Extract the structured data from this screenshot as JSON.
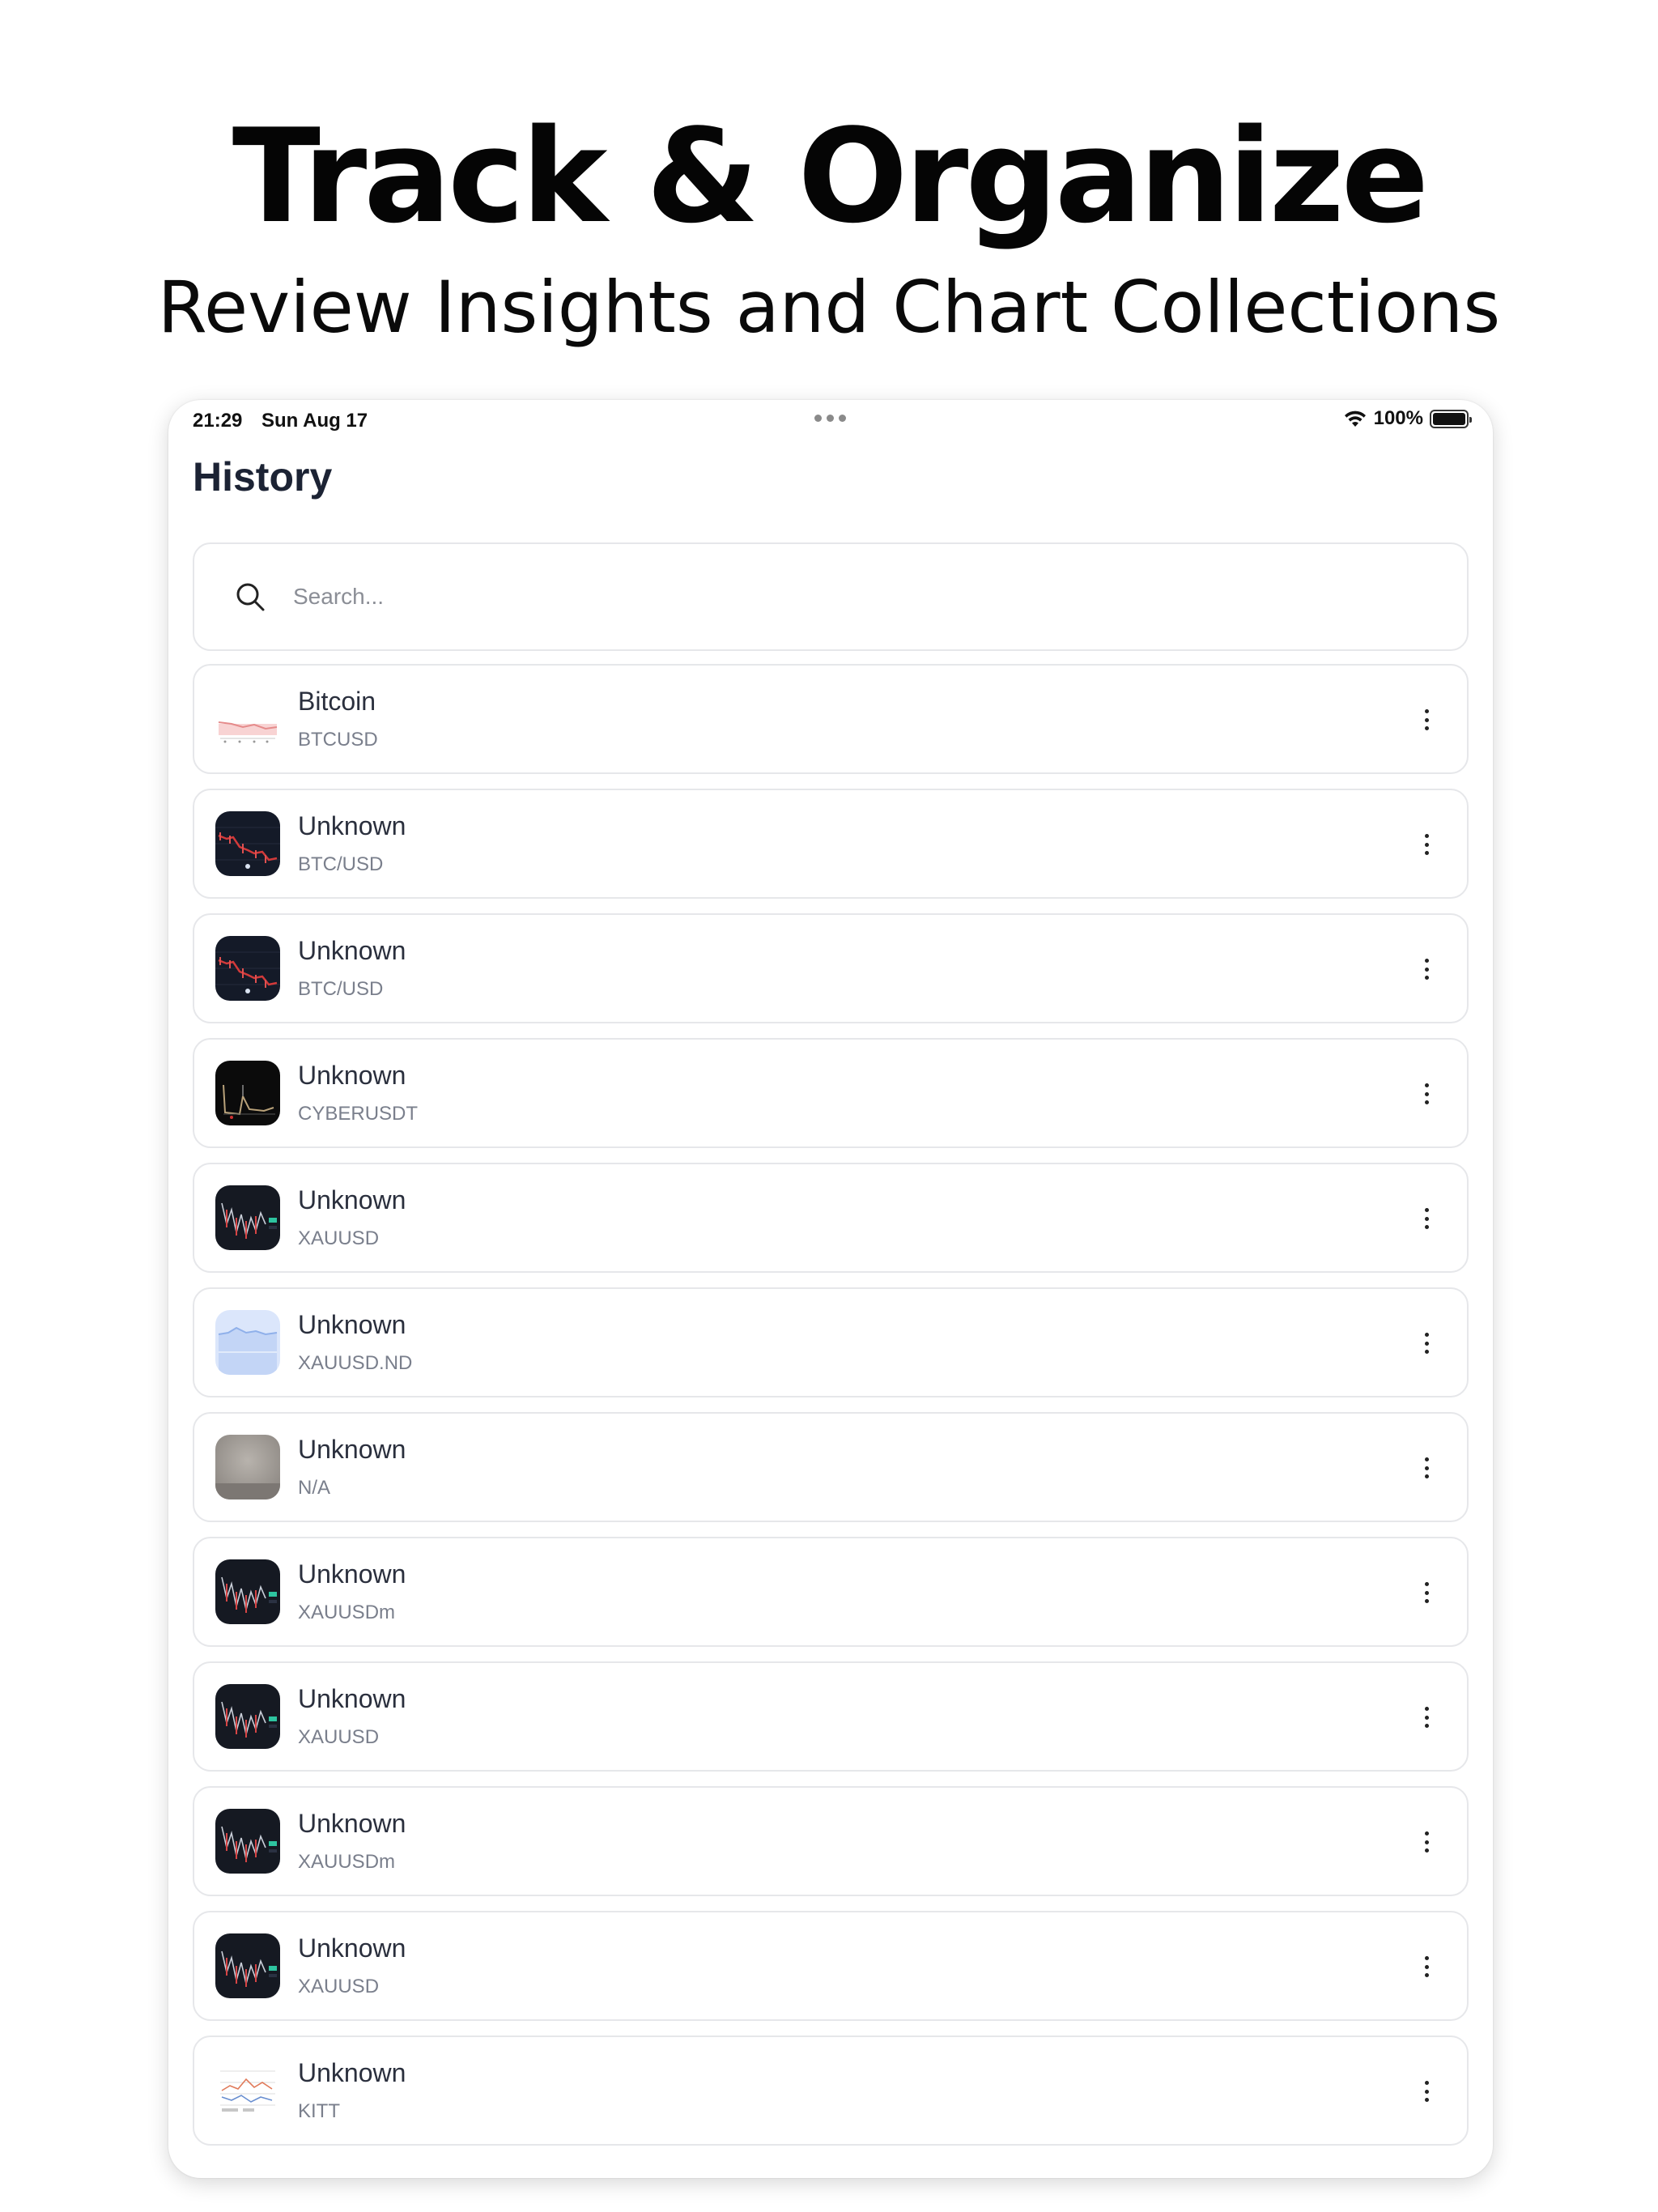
{
  "marketing": {
    "headline": "Track & Organize",
    "subheadline": "Review Insights and Chart Collections"
  },
  "status_bar": {
    "time": "21:29",
    "date": "Sun Aug 17",
    "battery": "100%"
  },
  "page": {
    "title": "History"
  },
  "search": {
    "placeholder": "Search..."
  },
  "items": [
    {
      "name": "Bitcoin",
      "symbol": "BTCUSD",
      "thumb": "light-red"
    },
    {
      "name": "Unknown",
      "symbol": "BTC/USD",
      "thumb": "dark-red"
    },
    {
      "name": "Unknown",
      "symbol": "BTC/USD",
      "thumb": "dark-red"
    },
    {
      "name": "Unknown",
      "symbol": "CYBERUSDT",
      "thumb": "black"
    },
    {
      "name": "Unknown",
      "symbol": "XAUUSD",
      "thumb": "dark"
    },
    {
      "name": "Unknown",
      "symbol": "XAUUSD.ND",
      "thumb": "light-blue"
    },
    {
      "name": "Unknown",
      "symbol": "N/A",
      "thumb": "gray"
    },
    {
      "name": "Unknown",
      "symbol": "XAUUSDm",
      "thumb": "dark"
    },
    {
      "name": "Unknown",
      "symbol": "XAUUSD",
      "thumb": "dark"
    },
    {
      "name": "Unknown",
      "symbol": "XAUUSDm",
      "thumb": "dark"
    },
    {
      "name": "Unknown",
      "symbol": "XAUUSD",
      "thumb": "dark"
    },
    {
      "name": "Unknown",
      "symbol": "KITT",
      "thumb": "light-table"
    }
  ],
  "colors": {
    "card_border": "#e6e7ea",
    "title": "#1c2334",
    "secondary_text": "#7a7f8c"
  }
}
